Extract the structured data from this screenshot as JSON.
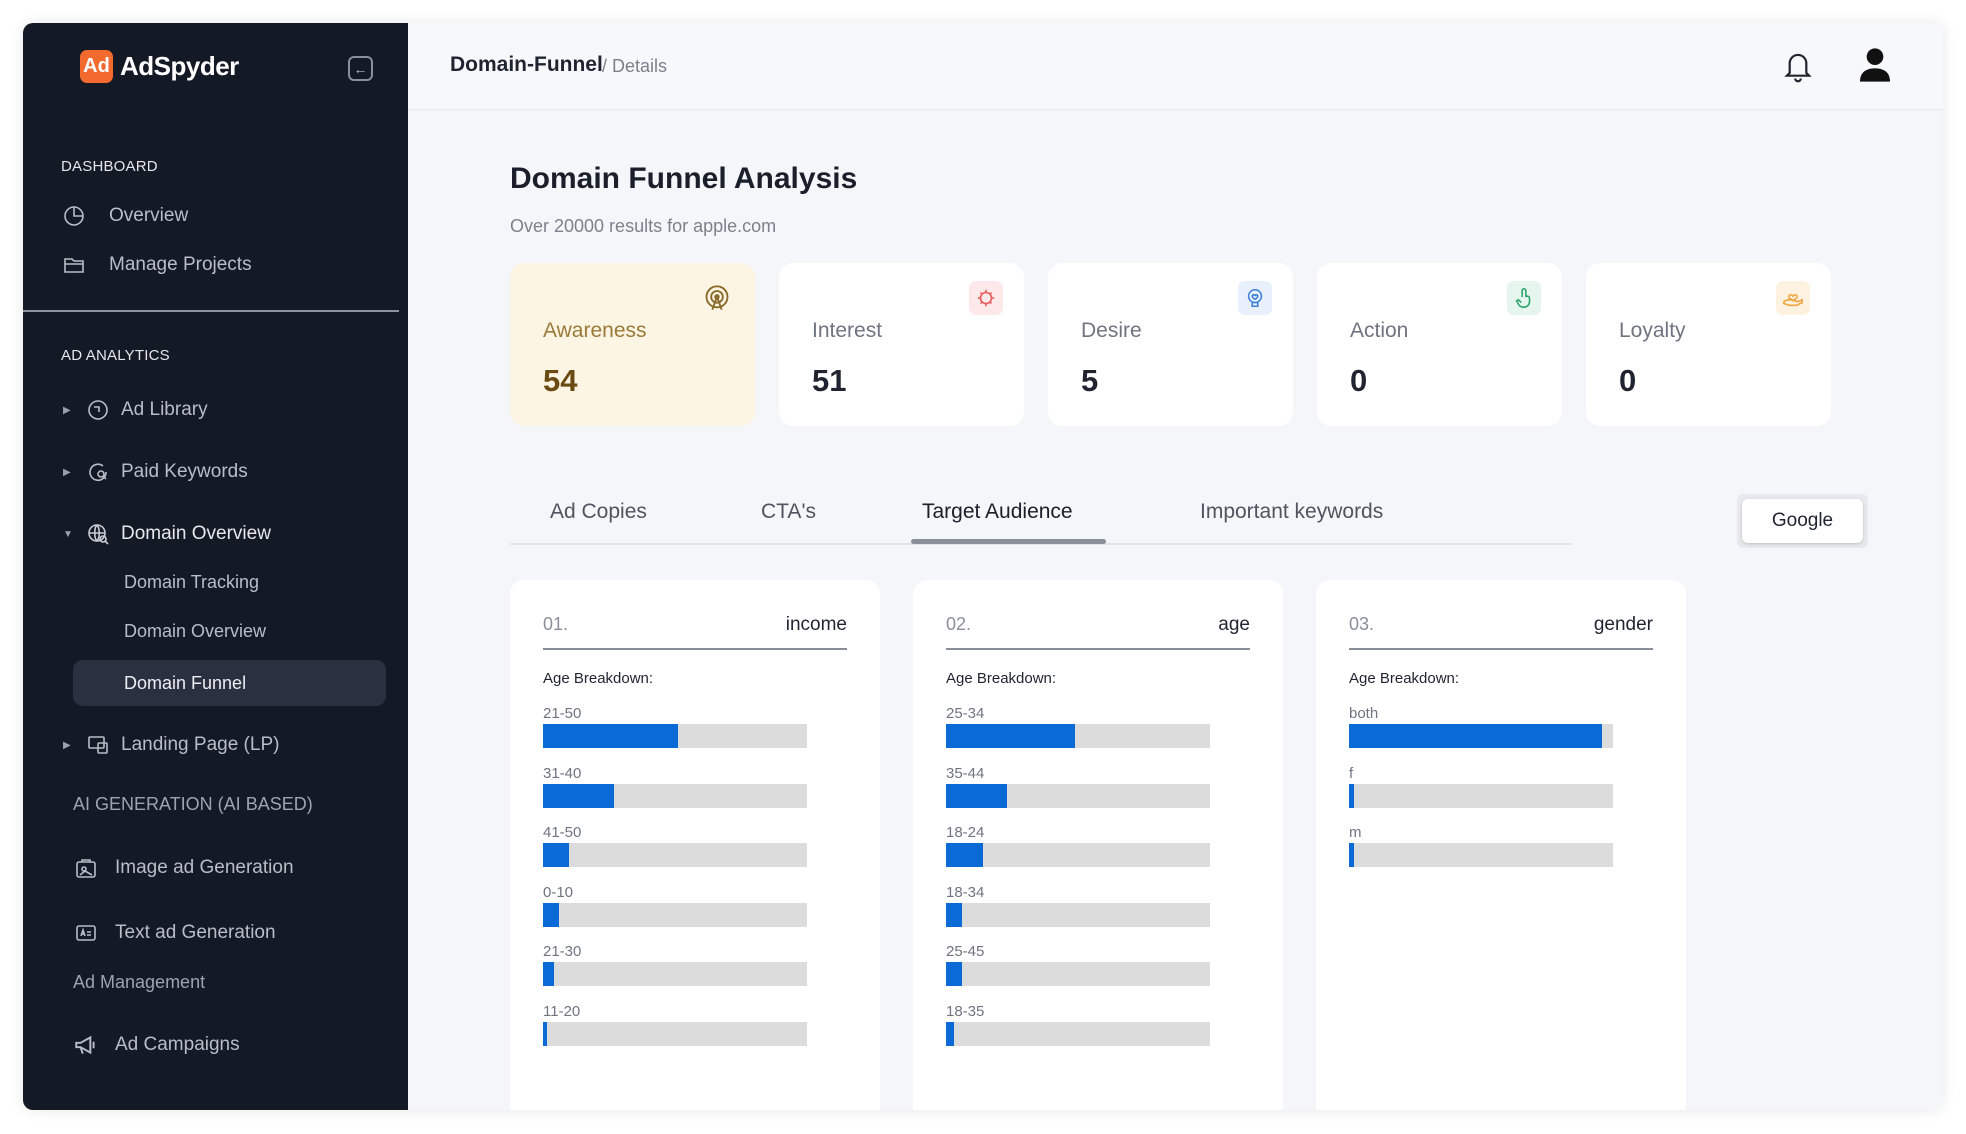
{
  "brand": {
    "name": "AdSpyder",
    "mark": "Ad"
  },
  "sidebar": {
    "dashboard_title": "DASHBOARD",
    "dashboard_items": [
      {
        "label": "Overview",
        "icon": "pie-chart-icon"
      },
      {
        "label": "Manage Projects",
        "icon": "folder-icon"
      }
    ],
    "analytics_title": "AD ANALYTICS",
    "analytics_items": [
      {
        "label": "Ad Library",
        "icon": "library-icon",
        "expanded": false
      },
      {
        "label": "Paid Keywords",
        "icon": "keyword-search-icon",
        "expanded": false
      },
      {
        "label": "Domain Overview",
        "icon": "globe-search-icon",
        "expanded": true
      },
      {
        "label": "Landing Page (LP)",
        "icon": "landing-page-icon",
        "expanded": false
      }
    ],
    "domain_sub_items": [
      {
        "label": "Domain Tracking",
        "active": false
      },
      {
        "label": "Domain Overview",
        "active": false
      },
      {
        "label": "Domain Funnel",
        "active": true
      }
    ],
    "ai_title": "AI GENERATION (AI BASED)",
    "ai_items": [
      {
        "label": "Image ad Generation",
        "icon": "image-ad-icon"
      },
      {
        "label": "Text ad Generation",
        "icon": "text-ad-icon"
      }
    ],
    "management_title": "Ad Management",
    "management_items": [
      {
        "label": "Ad Campaigns",
        "icon": "megaphone-icon"
      }
    ]
  },
  "header": {
    "breadcrumb_main": "Domain-Funnel",
    "breadcrumb_sub": "/ Details"
  },
  "page": {
    "title": "Domain Funnel Analysis",
    "subtitle": "Over 20000 results for apple.com"
  },
  "stats": [
    {
      "name": "Awareness",
      "value": "54",
      "icon": "radar-icon",
      "icon_color": "#8a6a2a",
      "icon_bg": "#fdf5e4",
      "highlighted": true
    },
    {
      "name": "Interest",
      "value": "51",
      "icon": "brain-icon",
      "icon_color": "#e85a5a",
      "icon_bg": "#fde9ea",
      "highlighted": false
    },
    {
      "name": "Desire",
      "value": "5",
      "icon": "heart-brain-icon",
      "icon_color": "#3d7fd8",
      "icon_bg": "#e8f0fb",
      "highlighted": false
    },
    {
      "name": "Action",
      "value": "0",
      "icon": "tap-icon",
      "icon_color": "#2aa56a",
      "icon_bg": "#e6f6ee",
      "highlighted": false
    },
    {
      "name": "Loyalty",
      "value": "0",
      "icon": "hand-heart-icon",
      "icon_color": "#f0a43a",
      "icon_bg": "#fdf1e0",
      "highlighted": false
    }
  ],
  "tabs": [
    {
      "label": "Ad Copies",
      "active": false
    },
    {
      "label": "CTA's",
      "active": false
    },
    {
      "label": "Target Audience",
      "active": true
    },
    {
      "label": "Important keywords",
      "active": false
    }
  ],
  "platform": {
    "selected": "Google"
  },
  "cards": [
    {
      "num": "01.",
      "key": "income",
      "subtitle": "Age Breakdown:",
      "bars": [
        {
          "label": "21-50",
          "fraction": 0.51
        },
        {
          "label": "31-40",
          "fraction": 0.27
        },
        {
          "label": "41-50",
          "fraction": 0.1
        },
        {
          "label": "0-10",
          "fraction": 0.06
        },
        {
          "label": "21-30",
          "fraction": 0.04
        },
        {
          "label": "11-20",
          "fraction": 0.01
        }
      ]
    },
    {
      "num": "02.",
      "key": "age",
      "subtitle": "Age Breakdown:",
      "bars": [
        {
          "label": "25-34",
          "fraction": 0.49
        },
        {
          "label": "35-44",
          "fraction": 0.23
        },
        {
          "label": "18-24",
          "fraction": 0.14
        },
        {
          "label": "18-34",
          "fraction": 0.06
        },
        {
          "label": "25-45",
          "fraction": 0.06
        },
        {
          "label": "18-35",
          "fraction": 0.03
        }
      ]
    },
    {
      "num": "03.",
      "key": "gender",
      "subtitle": "Age Breakdown:",
      "bars": [
        {
          "label": "both",
          "fraction": 0.96
        },
        {
          "label": "f",
          "fraction": 0.02
        },
        {
          "label": "m",
          "fraction": 0.02
        }
      ]
    }
  ]
}
